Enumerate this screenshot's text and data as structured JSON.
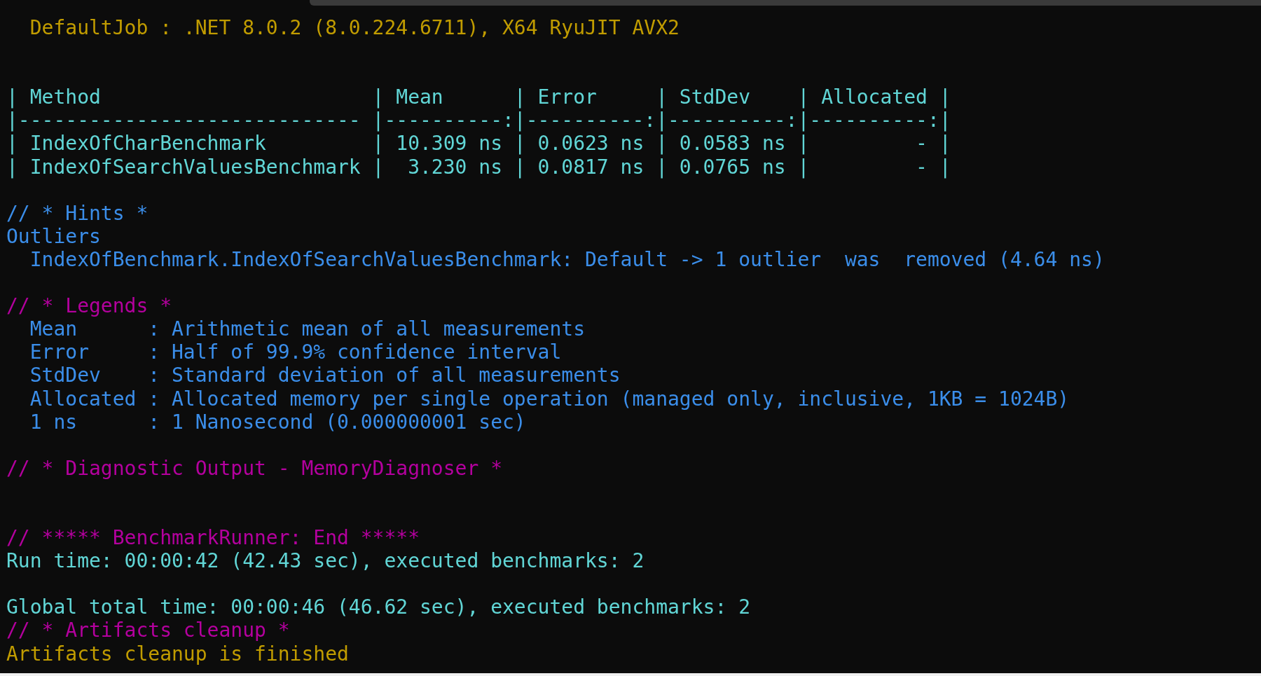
{
  "terminal": {
    "lines": [
      {
        "kind": "text",
        "text": "  DefaultJob : .NET 8.0.2 (8.0.224.6711), X64 RyuJIT AVX2",
        "color": "#c19c00"
      },
      {
        "kind": "blank"
      },
      {
        "kind": "blank"
      },
      {
        "kind": "text",
        "text": "| Method                       | Mean      | Error     | StdDev    | Allocated |",
        "color": "#61d6d6"
      },
      {
        "kind": "text",
        "text": "|----------------------------- |----------:|----------:|----------:|----------:|",
        "color": "#61d6d6"
      },
      {
        "kind": "text",
        "text": "| IndexOfCharBenchmark         | 10.309 ns | 0.0623 ns | 0.0583 ns |         - |",
        "color": "#61d6d6"
      },
      {
        "kind": "text",
        "text": "| IndexOfSearchValuesBenchmark |  3.230 ns | 0.0817 ns | 0.0765 ns |         - |",
        "color": "#61d6d6"
      },
      {
        "kind": "blank"
      },
      {
        "kind": "text",
        "text": "// * Hints *",
        "color": "#3b8eea"
      },
      {
        "kind": "text",
        "text": "Outliers",
        "color": "#3b8eea"
      },
      {
        "kind": "text",
        "text": "  IndexOfBenchmark.IndexOfSearchValuesBenchmark: Default -> 1 outlier  was  removed (4.64 ns)",
        "color": "#3b8eea"
      },
      {
        "kind": "blank"
      },
      {
        "kind": "text",
        "text": "// * Legends *",
        "color": "#b4009e"
      },
      {
        "kind": "text",
        "text": "  Mean      : Arithmetic mean of all measurements",
        "color": "#3b8eea"
      },
      {
        "kind": "text",
        "text": "  Error     : Half of 99.9% confidence interval",
        "color": "#3b8eea"
      },
      {
        "kind": "text",
        "text": "  StdDev    : Standard deviation of all measurements",
        "color": "#3b8eea"
      },
      {
        "kind": "text",
        "text": "  Allocated : Allocated memory per single operation (managed only, inclusive, 1KB = 1024B)",
        "color": "#3b8eea"
      },
      {
        "kind": "text",
        "text": "  1 ns      : 1 Nanosecond (0.000000001 sec)",
        "color": "#3b8eea"
      },
      {
        "kind": "blank"
      },
      {
        "kind": "text",
        "text": "// * Diagnostic Output - MemoryDiagnoser *",
        "color": "#b4009e"
      },
      {
        "kind": "blank"
      },
      {
        "kind": "blank"
      },
      {
        "kind": "text",
        "text": "// ***** BenchmarkRunner: End *****",
        "color": "#b4009e"
      },
      {
        "kind": "text",
        "text": "Run time: 00:00:42 (42.43 sec), executed benchmarks: 2",
        "color": "#61d6d6"
      },
      {
        "kind": "blank"
      },
      {
        "kind": "text",
        "text": "Global total time: 00:00:46 (46.62 sec), executed benchmarks: 2",
        "color": "#61d6d6"
      },
      {
        "kind": "text",
        "text": "// * Artifacts cleanup *",
        "color": "#b4009e"
      },
      {
        "kind": "text",
        "text": "Artifacts cleanup is finished",
        "color": "#c19c00"
      }
    ]
  }
}
